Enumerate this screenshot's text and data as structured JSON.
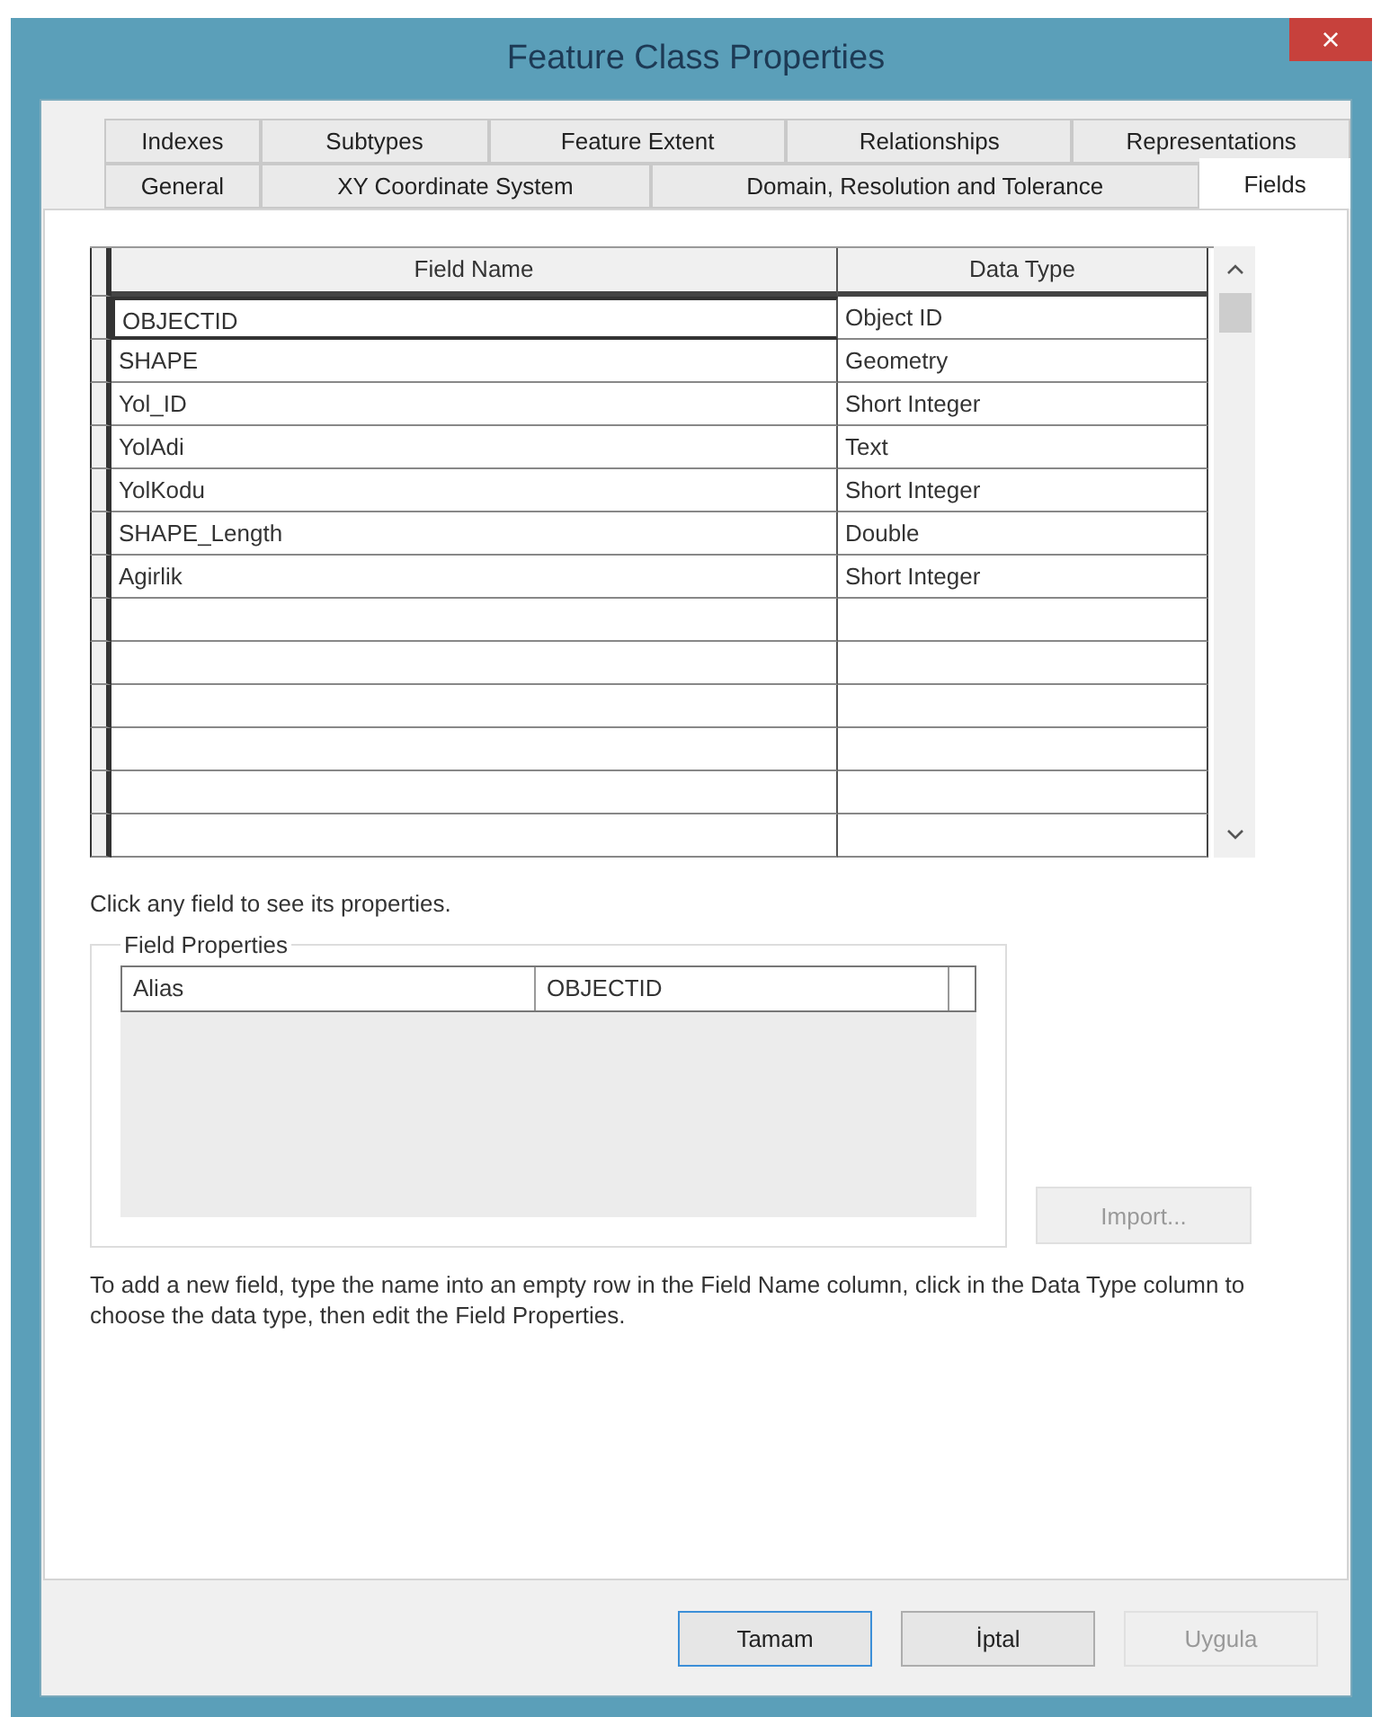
{
  "window": {
    "title": "Feature Class Properties",
    "close": "×"
  },
  "tab_rows": [
    [
      {
        "label": "Indexes",
        "selected": false
      },
      {
        "label": "Subtypes",
        "selected": false
      },
      {
        "label": "Feature Extent",
        "selected": false
      },
      {
        "label": "Relationships",
        "selected": false
      },
      {
        "label": "Representations",
        "selected": false
      }
    ],
    [
      {
        "label": "General",
        "selected": false
      },
      {
        "label": "XY Coordinate System",
        "selected": false
      },
      {
        "label": "Domain, Resolution and Tolerance",
        "selected": false
      },
      {
        "label": "Fields",
        "selected": true
      }
    ]
  ],
  "table": {
    "columns": [
      "Field Name",
      "Data Type"
    ],
    "rows": [
      {
        "name": "OBJECTID",
        "type": "Object ID",
        "selected": true
      },
      {
        "name": "SHAPE",
        "type": "Geometry",
        "selected": false
      },
      {
        "name": "Yol_ID",
        "type": "Short Integer",
        "selected": false
      },
      {
        "name": "YolAdi",
        "type": "Text",
        "selected": false
      },
      {
        "name": "YolKodu",
        "type": "Short Integer",
        "selected": false
      },
      {
        "name": "SHAPE_Length",
        "type": "Double",
        "selected": false
      },
      {
        "name": "Agirlik",
        "type": "Short Integer",
        "selected": false
      }
    ]
  },
  "hint": "Click any field to see its properties.",
  "field_properties": {
    "title": "Field Properties",
    "rows": [
      {
        "label": "Alias",
        "value": "OBJECTID"
      }
    ]
  },
  "import_button": {
    "label": "Import...",
    "disabled": true
  },
  "instructions": "To add a new field, type the name into an empty row in the Field Name column, click in the Data Type column to choose the data type, then edit the Field Properties.",
  "buttons": [
    {
      "label": "Tamam",
      "default": true,
      "disabled": false
    },
    {
      "label": "İptal",
      "default": false,
      "disabled": false
    },
    {
      "label": "Uygula",
      "default": false,
      "disabled": true
    }
  ]
}
